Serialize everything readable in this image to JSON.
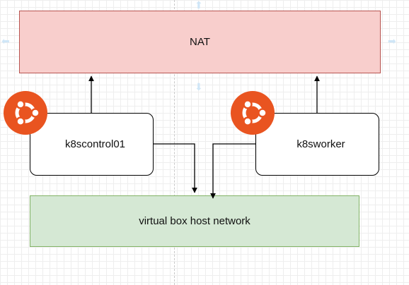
{
  "diagram": {
    "nat": {
      "label": "NAT",
      "fill": "#f8cecc",
      "stroke": "#b85450"
    },
    "host_network": {
      "label": "virtual box host network",
      "fill": "#d5e8d4",
      "stroke": "#82b366"
    },
    "nodes": {
      "control": {
        "label": "k8scontrol01",
        "os_icon": "ubuntu-icon"
      },
      "worker": {
        "label": "k8sworker",
        "os_icon": "ubuntu-icon"
      }
    },
    "edges": [
      {
        "from": "k8scontrol01",
        "to": "NAT"
      },
      {
        "from": "k8sworker",
        "to": "NAT"
      },
      {
        "from": "k8scontrol01",
        "to": "virtual box host network"
      },
      {
        "from": "k8sworker",
        "to": "virtual box host network"
      }
    ],
    "colors": {
      "ubuntu_orange": "#e95420",
      "connector": "#000000",
      "canvas_grid": "#eeeeee",
      "selection_hint": "#cfe6f7"
    }
  }
}
